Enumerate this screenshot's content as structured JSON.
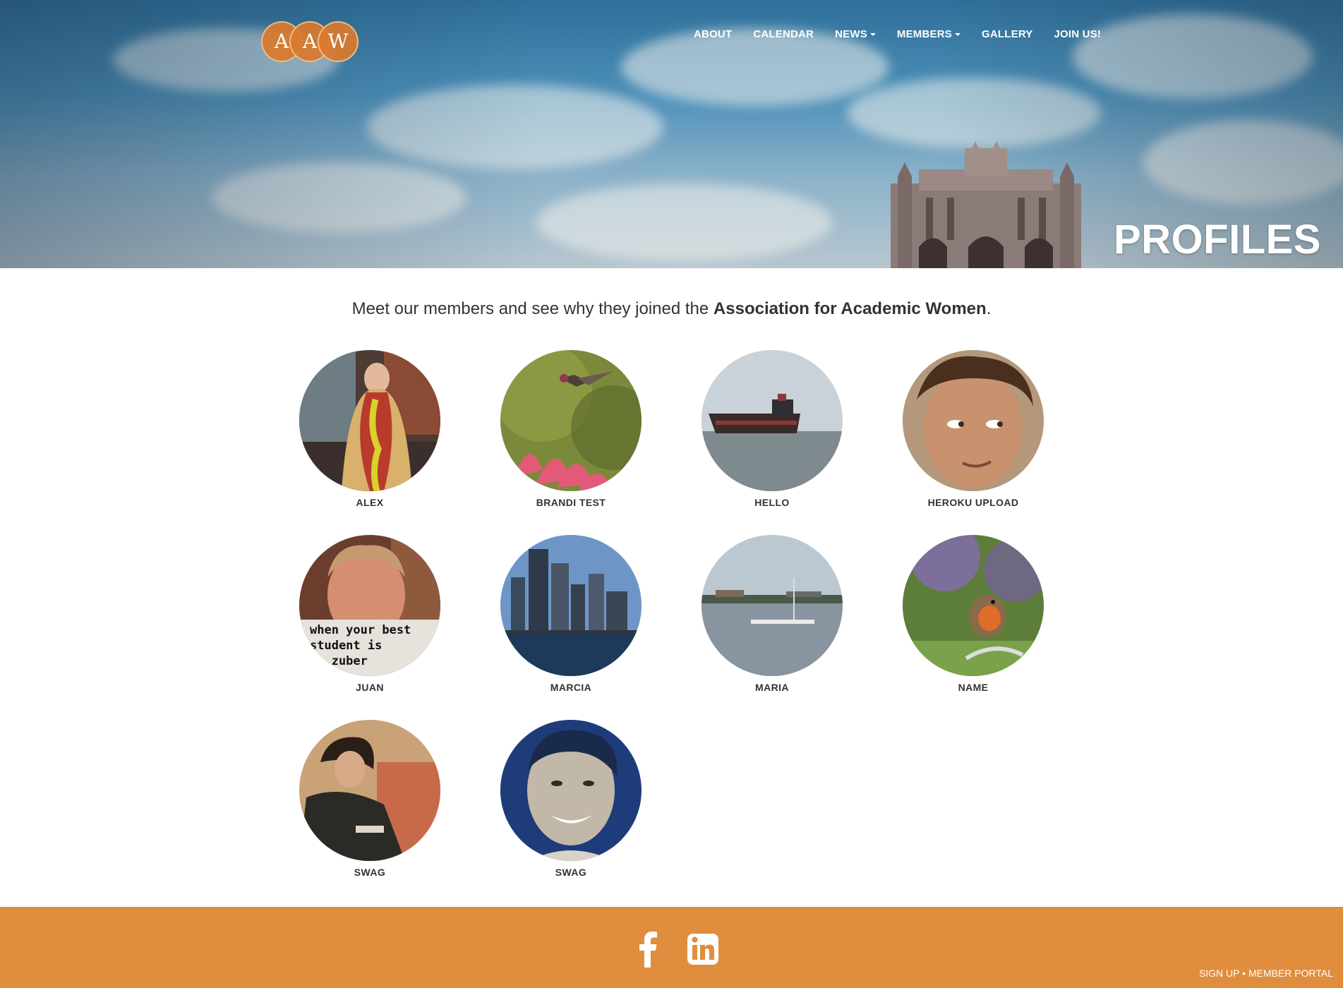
{
  "header": {
    "logo_letters": [
      "A",
      "A",
      "W"
    ],
    "nav": [
      {
        "label": "ABOUT",
        "dropdown": false
      },
      {
        "label": "CALENDAR",
        "dropdown": false
      },
      {
        "label": "NEWS",
        "dropdown": true
      },
      {
        "label": "MEMBERS",
        "dropdown": true
      },
      {
        "label": "GALLERY",
        "dropdown": false
      },
      {
        "label": "JOIN US!",
        "dropdown": false
      }
    ],
    "page_title": "PROFILES"
  },
  "intro": {
    "prefix": "Meet our members and see why they joined the ",
    "org_name": "Association for Academic Women",
    "suffix": "."
  },
  "members": [
    {
      "name": "ALEX"
    },
    {
      "name": "BRANDI TEST"
    },
    {
      "name": "HELLO"
    },
    {
      "name": "HEROKU UPLOAD"
    },
    {
      "name": "JUAN"
    },
    {
      "name": "MARCIA"
    },
    {
      "name": "MARIA"
    },
    {
      "name": "NAME"
    },
    {
      "name": "SWAG"
    },
    {
      "name": "SWAG"
    }
  ],
  "meme_caption": "when your best student is ic zuber",
  "footer": {
    "social": [
      "facebook-icon",
      "linkedin-icon"
    ],
    "sign_up": "SIGN UP",
    "separator": "•",
    "member_portal": "MEMBER PORTAL"
  },
  "colors": {
    "accent": "#e08d3e",
    "logo": "#d97a2c"
  }
}
